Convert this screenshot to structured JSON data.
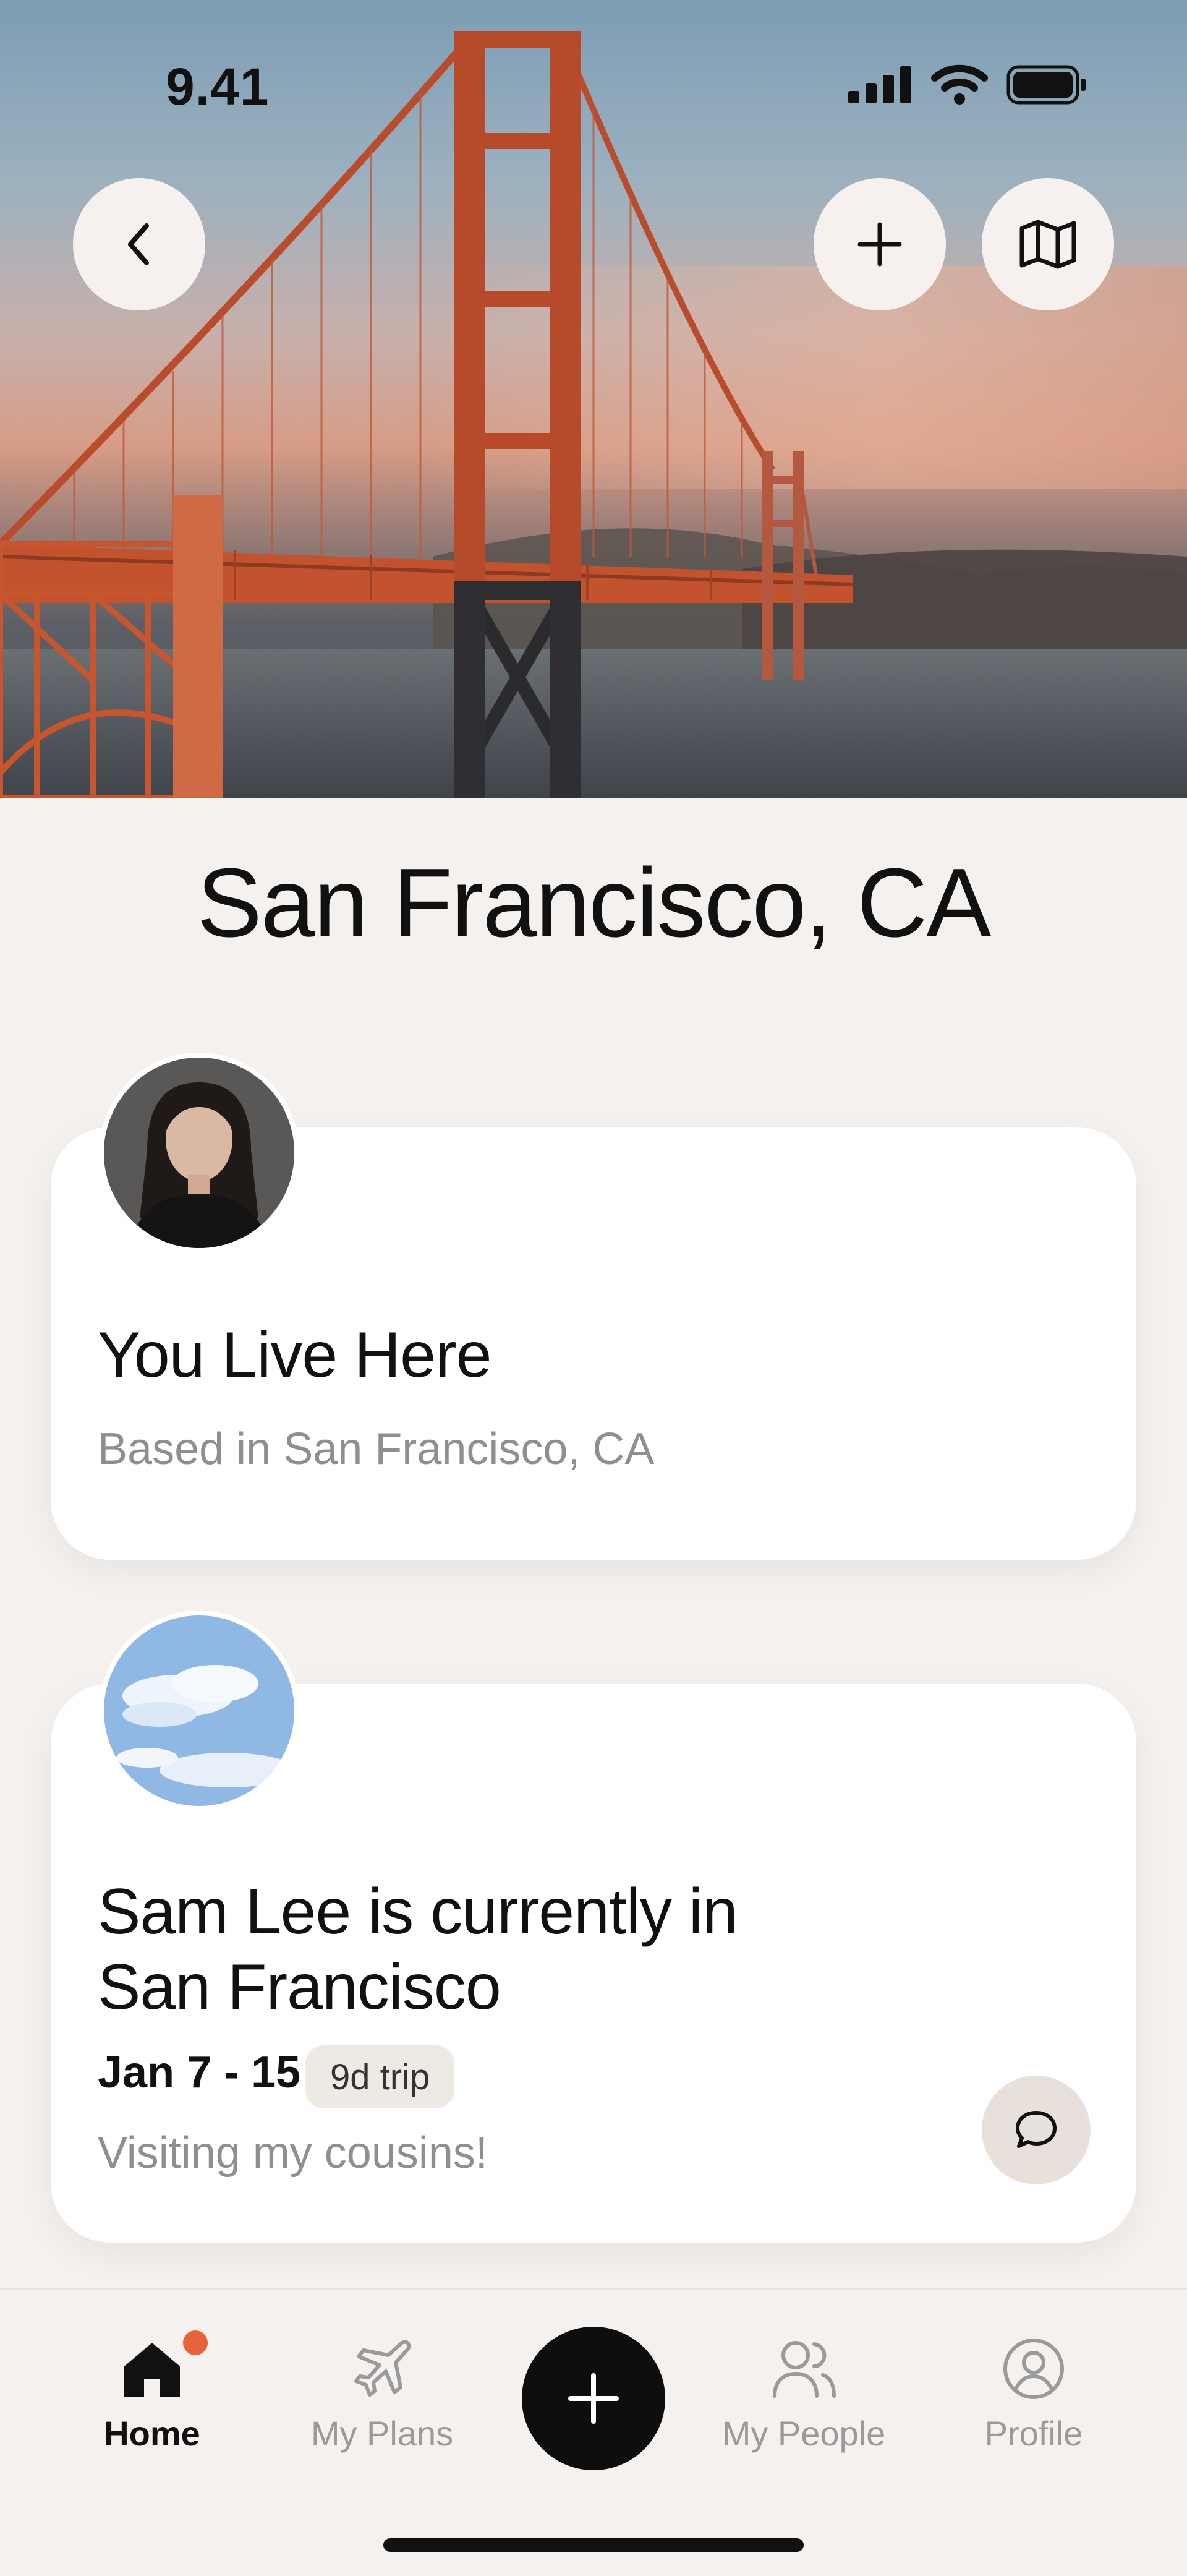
{
  "status_bar": {
    "time": "9.41"
  },
  "hero": {
    "image": "golden-gate-bridge-photo"
  },
  "header_buttons": {
    "back": "chevron-left-icon",
    "add": "plus-icon",
    "map": "map-icon"
  },
  "page": {
    "title": "San Francisco, CA"
  },
  "cards": [
    {
      "heading": "You Live Here",
      "subtitle": "Based in San Francisco, CA",
      "avatar": "portrait-photo"
    },
    {
      "heading_line1": "Sam Lee is currently in",
      "heading_line2": "San Francisco",
      "dates": "Jan 7 - 15",
      "badge": "9d trip",
      "note": "Visiting my cousins!",
      "avatar": "sky-clouds-photo",
      "action_icon": "chat-bubble-icon"
    }
  ],
  "tabbar": {
    "tabs": [
      {
        "label": "Home",
        "icon": "home-icon",
        "active": true,
        "has_notification_dot": true
      },
      {
        "label": "My Plans",
        "icon": "airplane-icon"
      },
      {
        "label": "My People",
        "icon": "people-icon"
      },
      {
        "label": "Profile",
        "icon": "profile-icon"
      }
    ],
    "center_button_icon": "plus-icon"
  },
  "colors": {
    "accent_dot": "#e8623a",
    "fab": "#0e0e0e",
    "background": "#f4f1ee"
  }
}
